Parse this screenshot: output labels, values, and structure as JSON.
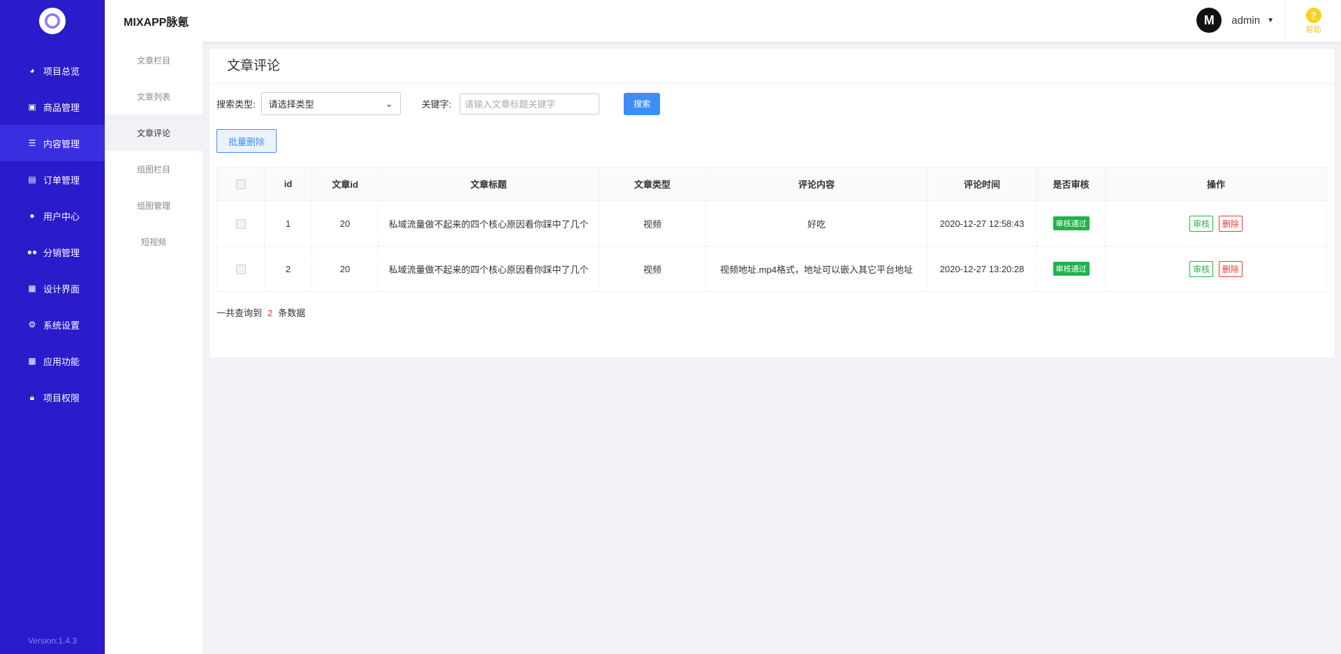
{
  "sidebar": {
    "items": [
      {
        "label": "项目总览",
        "icon": "pie-chart-icon"
      },
      {
        "label": "商品管理",
        "icon": "shopping-bag-icon"
      },
      {
        "label": "内容管理",
        "icon": "list-icon"
      },
      {
        "label": "订单管理",
        "icon": "clipboard-icon"
      },
      {
        "label": "用户中心",
        "icon": "user-icon"
      },
      {
        "label": "分销管理",
        "icon": "users-icon"
      },
      {
        "label": "设计界面",
        "icon": "layout-icon"
      },
      {
        "label": "系统设置",
        "icon": "gear-icon"
      },
      {
        "label": "应用功能",
        "icon": "grid-icon"
      },
      {
        "label": "项目权限",
        "icon": "lock-icon"
      }
    ],
    "active_index": 2,
    "version": "Version:1.4.3"
  },
  "subnav": {
    "items": [
      "文章栏目",
      "文章列表",
      "文章评论",
      "组图栏目",
      "组图管理",
      "短视频"
    ],
    "active_index": 2
  },
  "header": {
    "brand": "MIXAPP脉氪",
    "username": "admin",
    "avatar_text": "M",
    "help_label": "帮助"
  },
  "page": {
    "title": "文章评论",
    "search_type_label": "搜索类型:",
    "search_type_value": "请选择类型",
    "keyword_label": "关键字:",
    "keyword_placeholder": "请输入文章标题关键字",
    "search_button": "搜索",
    "batch_delete_button": "批量删除"
  },
  "table": {
    "headers": [
      "id",
      "文章id",
      "文章标题",
      "文章类型",
      "评论内容",
      "评论时间",
      "是否审核",
      "操作"
    ],
    "rows": [
      {
        "id": "1",
        "article_id": "20",
        "title": "私域流量做不起来的四个核心原因看你踩中了几个",
        "type": "视频",
        "content": "好吃",
        "time": "2020-12-27 12:58:43",
        "status": "审核通过",
        "review": "审核",
        "delete": "删除"
      },
      {
        "id": "2",
        "article_id": "20",
        "title": "私域流量做不起来的四个核心原因看你踩中了几个",
        "type": "视频",
        "content": "视频地址.mp4格式，地址可以嵌入其它平台地址",
        "time": "2020-12-27 13:20:28",
        "status": "审核通过",
        "review": "审核",
        "delete": "删除"
      }
    ]
  },
  "summary": {
    "prefix": "一共查询到",
    "count": "2",
    "suffix": "条数据"
  },
  "colors": {
    "sidebar": "#2a1bcb",
    "primary": "#3e8ef7",
    "success": "#22b14c",
    "danger": "#e53935"
  }
}
